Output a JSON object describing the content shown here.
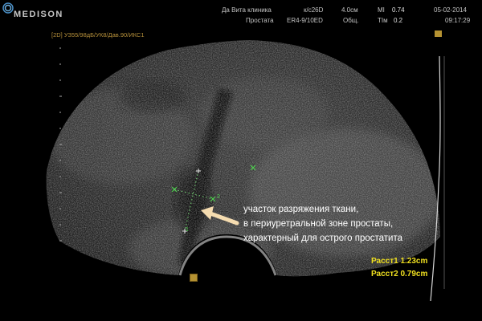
{
  "header": {
    "brand": "MEDISON",
    "clinic": "Да Вита клиника",
    "exam": "Простата",
    "probe": "к/с26D",
    "preset": "ER4-9/10ED",
    "depth": "4.0см",
    "mode": "Общ.",
    "mi_label": "MI",
    "mi_value": "0.74",
    "tib_label": "TIм",
    "tib_value": "0.2",
    "date": "05-02-2014",
    "time": "09:17:29"
  },
  "scan_params": "[2D] УЗ55/98дБ/УК8/Дав.90/ИКС1",
  "annotation": {
    "line1": "участок  разряжения ткани,",
    "line2": "в периуретральной зоне простаты,",
    "line3": "характерный для острого простатита"
  },
  "measurements": {
    "m1": "Расст1 1.23cm",
    "m2": "Расст2 0.79cm"
  },
  "caliper_labels": {
    "c1": "1",
    "c2": "2"
  },
  "colors": {
    "marker": "#b59232",
    "measure_text": "#f0e020",
    "caliper": "#4fd04f",
    "arrow": "#f5dcb0"
  }
}
